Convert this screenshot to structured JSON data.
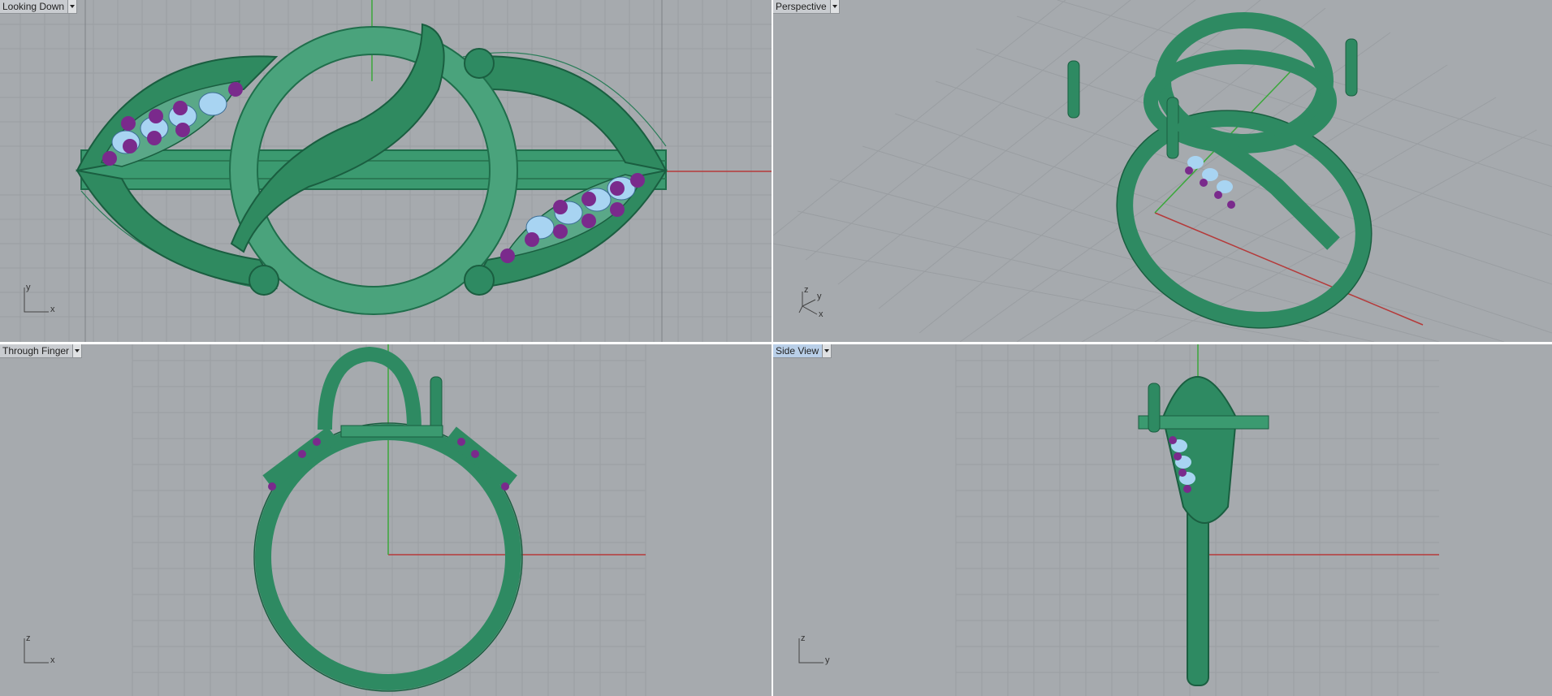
{
  "viewports": {
    "top_left": {
      "title": "Looking Down",
      "axis": {
        "v": "y",
        "h": "x"
      }
    },
    "top_right": {
      "title": "Perspective",
      "axis": {
        "v": "z",
        "d": "y",
        "h": "x"
      }
    },
    "bottom_left": {
      "title": "Through Finger",
      "axis": {
        "v": "z",
        "h": "x"
      }
    },
    "bottom_right": {
      "title": "Side View",
      "axis": {
        "v": "z",
        "h": "y"
      },
      "active": true
    }
  },
  "colors": {
    "background": "#a6aaae",
    "grid": "#8c9095",
    "model": "#2e8a62",
    "gem": "#a8d4f2",
    "prong_gem": "#7a2a8c",
    "x_axis": "#b53a3a",
    "y_axis": "#3aa83a"
  },
  "icons": {
    "dropdown": "chevron-down-icon"
  }
}
